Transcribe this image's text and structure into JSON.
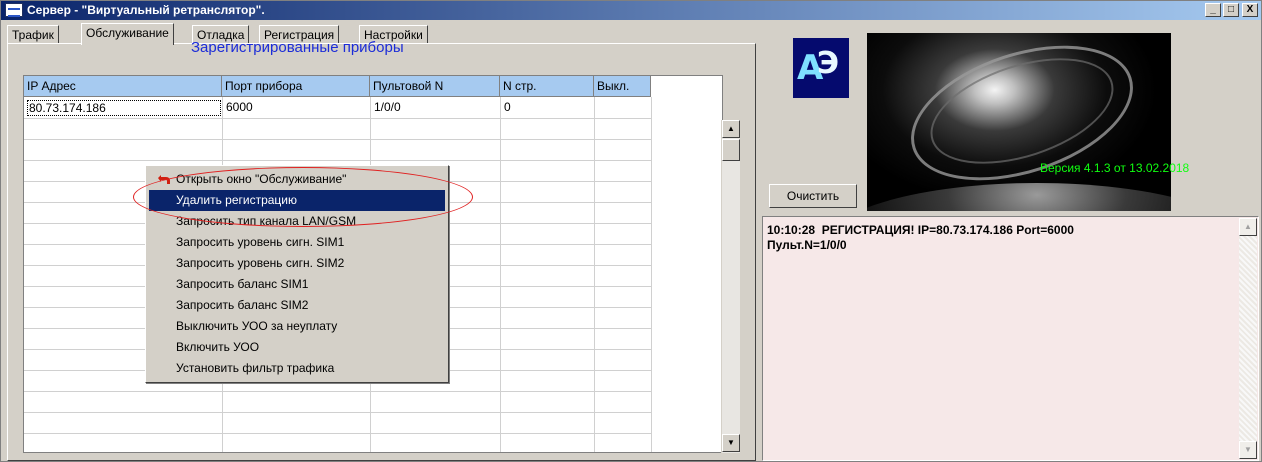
{
  "window": {
    "title": "Сервер - \"Виртуальный ретранслятор\".",
    "controls": [
      "_",
      "□",
      "X"
    ]
  },
  "tabs": [
    {
      "label": "Трафик",
      "active": false
    },
    {
      "label": "Обслуживание",
      "active": true
    },
    {
      "label": "Отладка",
      "active": false
    },
    {
      "label": "Регистрация",
      "active": false
    },
    {
      "label": "Настройки",
      "active": false
    }
  ],
  "panel": {
    "title": "Зарегистрированные приборы"
  },
  "table": {
    "columns": [
      "IP Адрес",
      "Порт прибора",
      "Пультовой N",
      "N стр.",
      "Выкл."
    ],
    "rows": [
      [
        "80.73.174.186",
        "6000",
        "1/0/0",
        "0",
        ""
      ]
    ]
  },
  "context_menu": {
    "items": [
      {
        "label": "Открыть окно \"Обслуживание\"",
        "selected": false,
        "icon": "open-window-icon"
      },
      {
        "label": "Удалить регистрацию",
        "selected": true
      },
      {
        "label": "Запросить тип канала LAN/GSM",
        "selected": false
      },
      {
        "label": "Запросить уровень сигн. SIM1",
        "selected": false
      },
      {
        "label": "Запросить уровень сигн. SIM2",
        "selected": false
      },
      {
        "label": "Запросить баланс SIM1",
        "selected": false
      },
      {
        "label": "Запросить баланс SIM2",
        "selected": false
      },
      {
        "label": "Выключить УОО за неуплату",
        "selected": false
      },
      {
        "label": "Включить УОО",
        "selected": false
      },
      {
        "label": "Установить фильтр трафика",
        "selected": false
      }
    ]
  },
  "logo": {
    "text_a": "А",
    "text_e": "Э"
  },
  "version_text": "Версия  4.1.3 от 13.02.2018",
  "clear_button": "Очистить",
  "log": {
    "text": "10:10:28  РЕГИСТРАЦИЯ! IP=80.73.174.186 Port=6000\nПульт.N=1/0/0"
  },
  "colors": {
    "title_start": "#0a246a",
    "header_bg": "#a6caf0",
    "selection": "#0a246a",
    "panel_title": "#1c2cd8",
    "version": "#10ff10",
    "log_bg": "#f6e8e8",
    "highlight_ellipse": "#e02020"
  }
}
